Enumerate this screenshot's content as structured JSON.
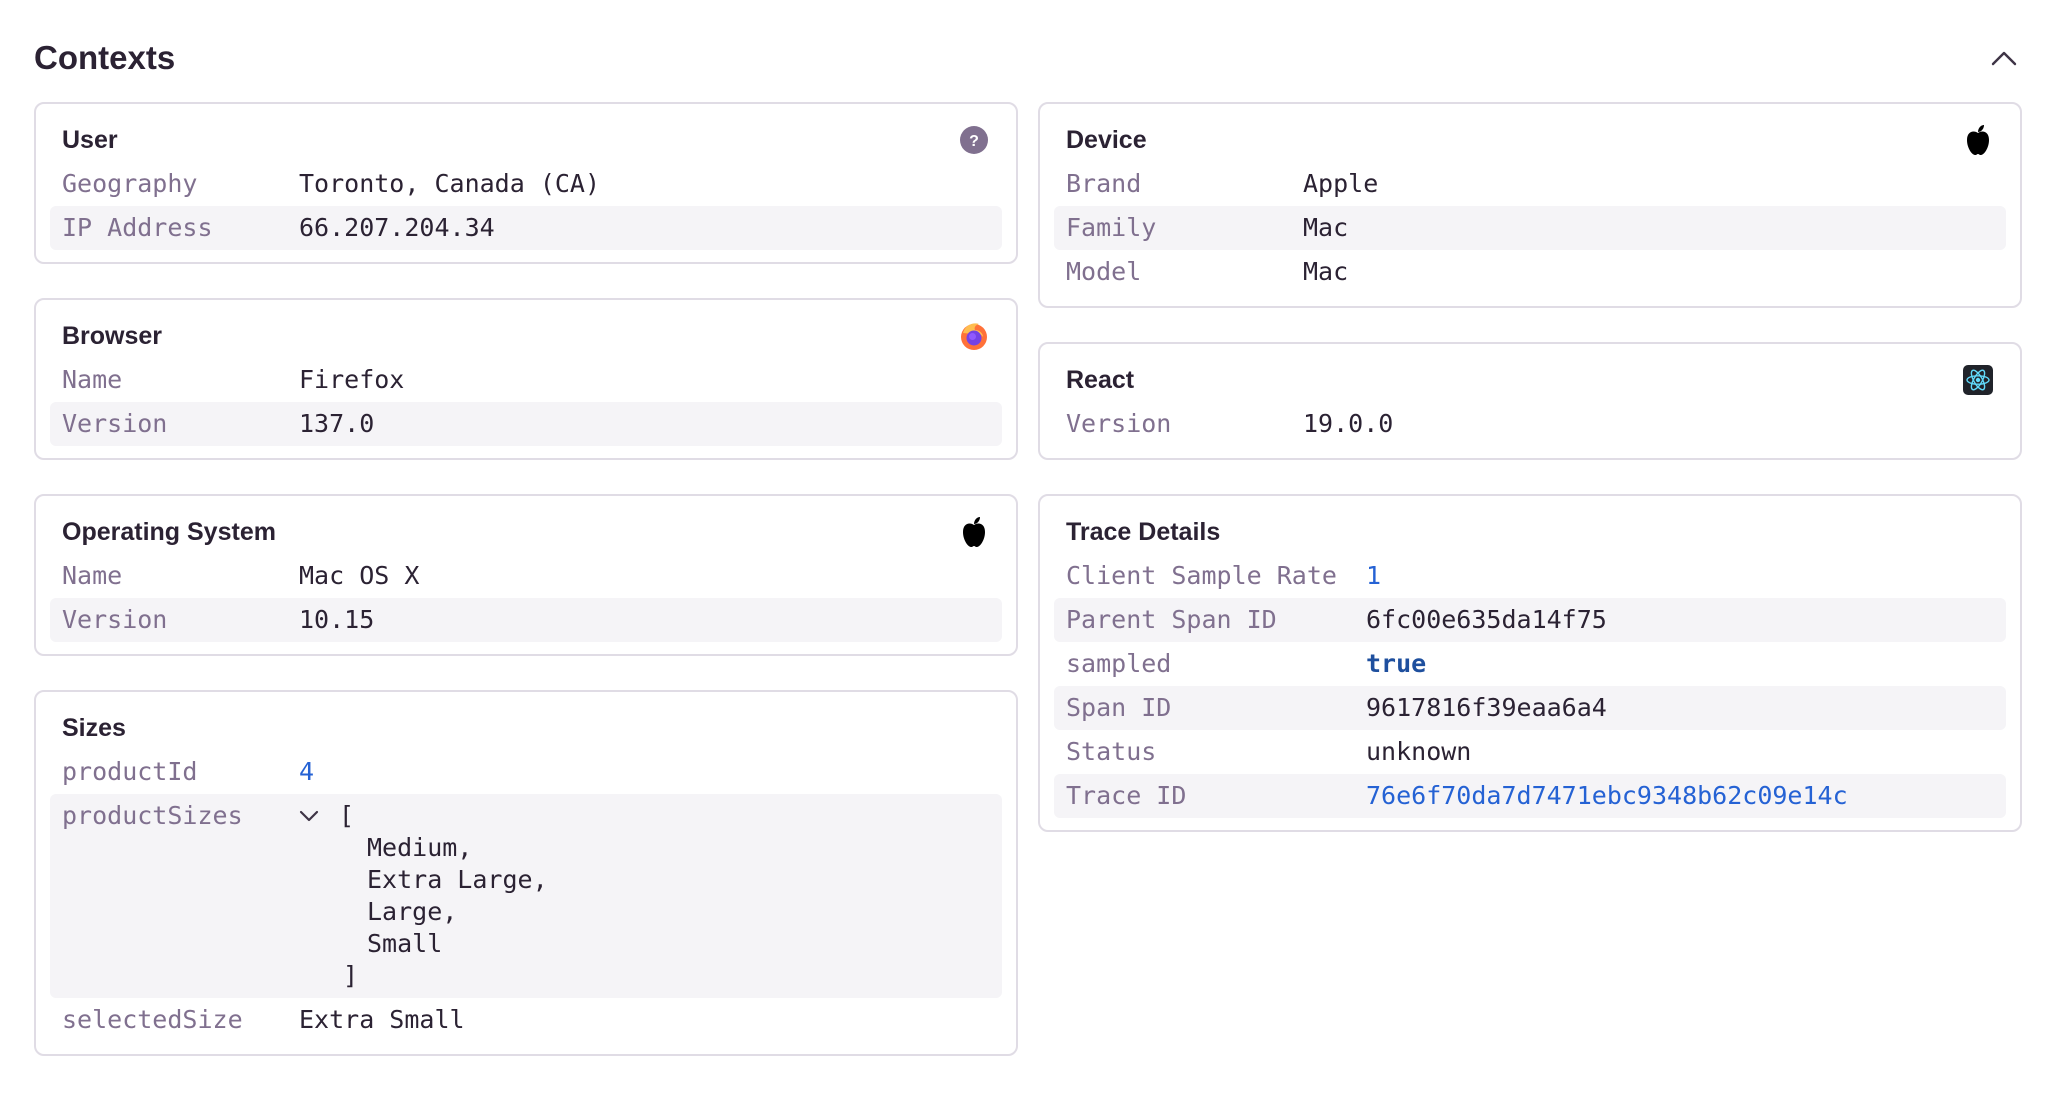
{
  "section": {
    "title": "Contexts",
    "collapse_icon": "chevron-up-icon"
  },
  "user": {
    "title": "User",
    "icon": "help-circle-icon",
    "rows": [
      {
        "key": "Geography",
        "value": "Toronto, Canada (CA)"
      },
      {
        "key": "IP Address",
        "value": "66.207.204.34"
      }
    ]
  },
  "browser": {
    "title": "Browser",
    "icon": "firefox-icon",
    "rows": [
      {
        "key": "Name",
        "value": "Firefox"
      },
      {
        "key": "Version",
        "value": "137.0"
      }
    ]
  },
  "os": {
    "title": "Operating System",
    "icon": "apple-icon",
    "rows": [
      {
        "key": "Name",
        "value": "Mac OS X"
      },
      {
        "key": "Version",
        "value": "10.15"
      }
    ]
  },
  "sizes": {
    "title": "Sizes",
    "product_id": {
      "key": "productId",
      "value": "4"
    },
    "product_sizes": {
      "key": "productSizes",
      "open_bracket": "[",
      "items": [
        "Medium,",
        "Extra Large,",
        "Large,",
        "Small"
      ],
      "close_bracket": "]"
    },
    "selected_size": {
      "key": "selectedSize",
      "value": "Extra Small"
    }
  },
  "device": {
    "title": "Device",
    "icon": "apple-icon",
    "rows": [
      {
        "key": "Brand",
        "value": "Apple"
      },
      {
        "key": "Family",
        "value": "Mac"
      },
      {
        "key": "Model",
        "value": "Mac"
      }
    ]
  },
  "react": {
    "title": "React",
    "icon": "react-icon",
    "rows": [
      {
        "key": "Version",
        "value": "19.0.0"
      }
    ]
  },
  "trace": {
    "title": "Trace Details",
    "rows": [
      {
        "key": "Client Sample Rate",
        "value": "1"
      },
      {
        "key": "Parent Span ID",
        "value": "6fc00e635da14f75"
      },
      {
        "key": "sampled",
        "value": "true"
      },
      {
        "key": "Span ID",
        "value": "9617816f39eaa6a4"
      },
      {
        "key": "Status",
        "value": "unknown"
      },
      {
        "key": "Trace ID",
        "value": "76e6f70da7d7471ebc9348b62c09e14c"
      }
    ]
  },
  "colors": {
    "key_text": "#80708f",
    "value_text": "#2b2233",
    "link": "#2562d4",
    "bool": "#1e4f9e",
    "border": "#e0dce5",
    "row_alt": "#f5f4f7"
  }
}
